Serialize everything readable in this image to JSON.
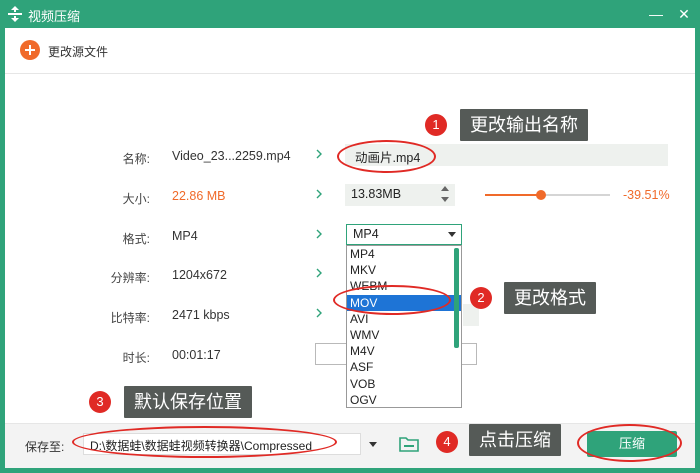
{
  "window": {
    "title": "视频压缩",
    "minimize_glyph": "—",
    "close_glyph": "✕"
  },
  "toolbar": {
    "add_source_label": "更改源文件"
  },
  "fields": {
    "name": {
      "label": "名称:",
      "source": "Video_23...2259.mp4",
      "output": "动画片.mp4"
    },
    "size": {
      "label": "大小:",
      "source": "22.86 MB",
      "output": "13.83MB",
      "slider_level_percent": 45,
      "ratio": "-39.51%"
    },
    "format": {
      "label": "格式:",
      "source": "MP4",
      "selected": "MP4"
    },
    "resolution": {
      "label": "分辨率:",
      "source": "1204x672"
    },
    "bitrate": {
      "label": "比特率:",
      "source": "2471 kbps"
    },
    "duration": {
      "label": "时长:",
      "source": "00:01:17"
    }
  },
  "format_dropdown": {
    "options": [
      "MP4",
      "MKV",
      "WEBM",
      "MOV",
      "AVI",
      "WMV",
      "M4V",
      "ASF",
      "VOB",
      "OGV"
    ],
    "highlighted": "MOV"
  },
  "bottom": {
    "save_label": "保存至:",
    "save_path": "D:\\数据蛙\\数据蛙视频转换器\\Compressed",
    "compress_button": "压缩"
  },
  "callouts": [
    {
      "number": "1",
      "text": "更改输出名称"
    },
    {
      "number": "2",
      "text": "更改格式"
    },
    {
      "number": "3",
      "text": "默认保存位置"
    },
    {
      "number": "4",
      "text": "点击压缩"
    }
  ],
  "colors": {
    "accent": "#2fa37a",
    "warning": "#f06a2a",
    "annotation": "#e02a25",
    "callout_bg": "#555a57",
    "selection": "#1e74d6"
  }
}
